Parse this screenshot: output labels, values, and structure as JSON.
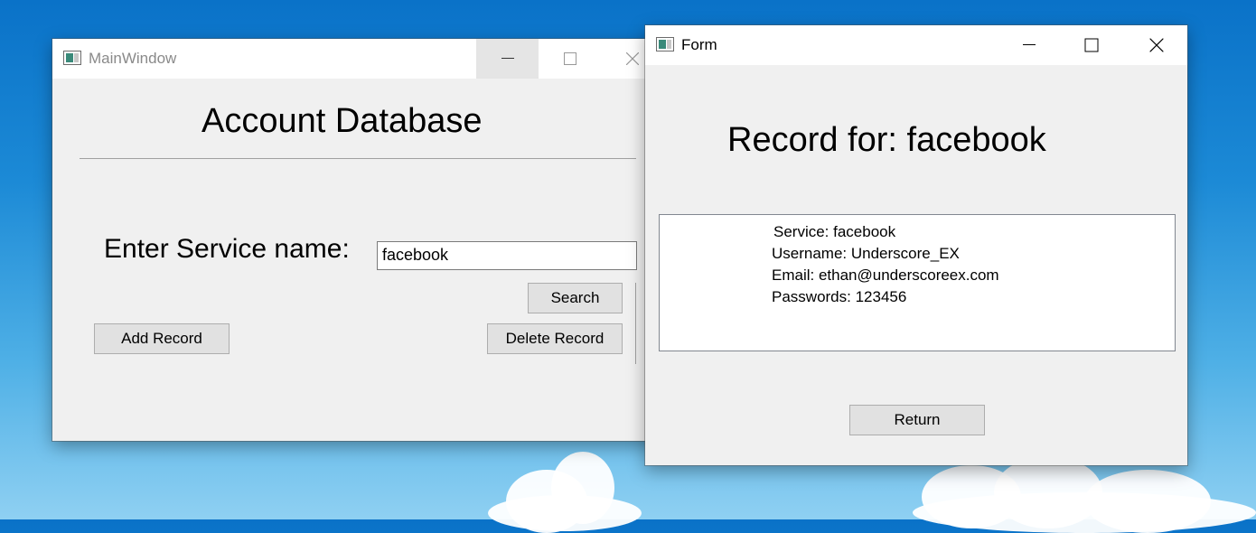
{
  "colors": {
    "desktop_top": "#0a72c8",
    "desktop_bottom": "#8fd0f2",
    "window_bg": "#f0f0f0",
    "button_bg": "#e1e1e1"
  },
  "main_window": {
    "title": "MainWindow",
    "icon": "qt-app-icon",
    "heading": "Account Database",
    "service_label": "Enter Service name:",
    "service_input_value": "facebook",
    "search_button": "Search",
    "add_record_button": "Add Record",
    "delete_record_button": "Delete Record"
  },
  "form_window": {
    "title": "Form",
    "icon": "qt-app-icon",
    "heading": "Record for: facebook",
    "record_lines": [
      "Service: facebook",
      "Username: Underscore_EX",
      "Email: ethan@underscoreex.com",
      "Passwords: 123456"
    ],
    "return_button": "Return"
  }
}
